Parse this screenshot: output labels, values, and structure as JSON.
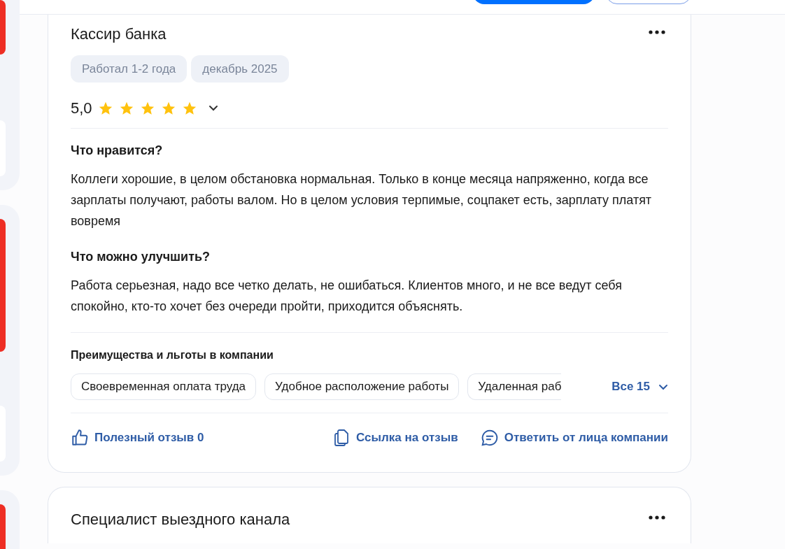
{
  "side_cards": [
    {
      "flagged": true
    },
    {
      "flagged": true
    },
    {
      "flagged": true
    }
  ],
  "reviews": [
    {
      "title": "Кассир банка",
      "tags": [
        "Работал 1-2 года",
        "декабрь 2025"
      ],
      "rating": "5,0",
      "stars": 5,
      "expanded": false,
      "sections": [
        {
          "heading": "Что нравится?",
          "text": "Коллеги хорошие, в целом обстановка нормальная. Только в конце месяца напряженно, когда все зарплаты получают, работы валом. Но в целом условия терпимые, соцпакет есть, зарплату платят вовремя"
        },
        {
          "heading": "Что можно улучшить?",
          "text": "Работа серьезная, надо все четко делать, не ошибаться. Клиентов много, и не все ведут себя спокойно, кто-то хочет без очереди пройти, приходится объяснять."
        }
      ],
      "benefits": {
        "heading": "Преимущества и льготы в компании",
        "items": [
          "Своевременная оплата труда",
          "Удобное расположение работы",
          "Удаленная раб"
        ],
        "more": "Все 15"
      },
      "actions": {
        "helpful": "Полезный отзыв 0",
        "link": "Ссылка на отзыв",
        "reply": "Ответить от лица компании"
      }
    },
    {
      "title": "Специалист выездного канала"
    }
  ]
}
